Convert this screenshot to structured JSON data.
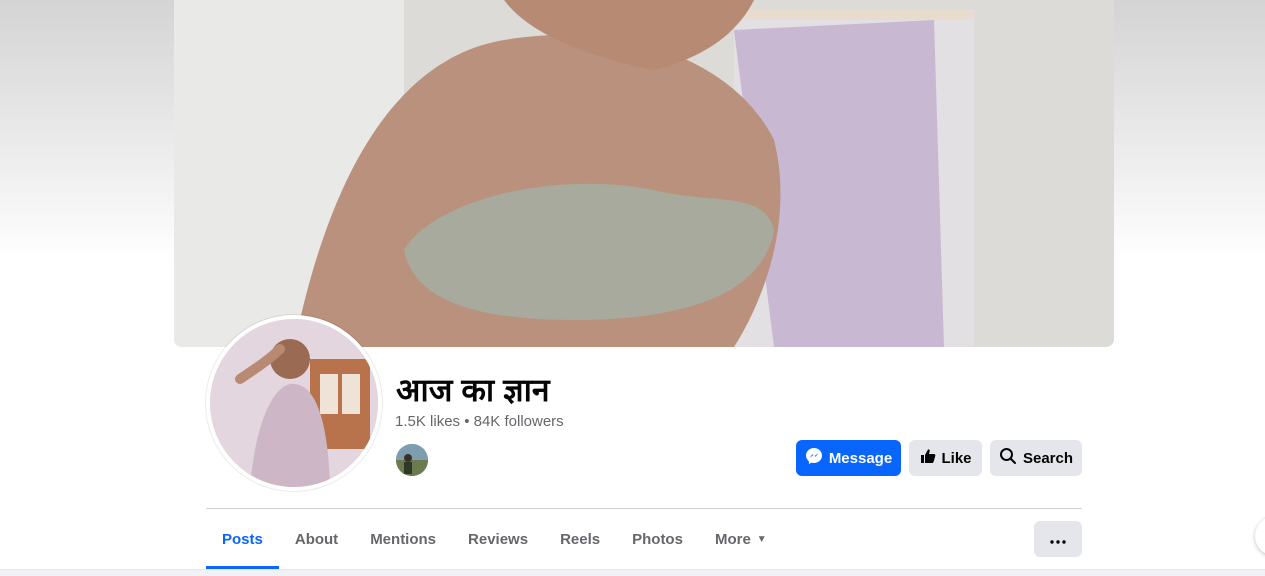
{
  "page": {
    "name": "आज का ज्ञान",
    "stats": "1.5K likes • 84K followers"
  },
  "actions": {
    "message_label": "Message",
    "like_label": "Like",
    "search_label": "Search"
  },
  "tabs": [
    {
      "label": "Posts",
      "active": true
    },
    {
      "label": "About",
      "active": false
    },
    {
      "label": "Mentions",
      "active": false
    },
    {
      "label": "Reviews",
      "active": false
    },
    {
      "label": "Reels",
      "active": false
    },
    {
      "label": "Photos",
      "active": false
    },
    {
      "label": "More",
      "active": false
    }
  ],
  "icons": {
    "message": "messenger-icon",
    "like": "thumbs-up-icon",
    "search": "search-icon",
    "more_tab": "caret-down-icon",
    "menu": "more-dots-icon"
  },
  "colors": {
    "accent": "#0866ff",
    "secondary_button": "#e4e6eb",
    "muted_text": "#65676b"
  }
}
